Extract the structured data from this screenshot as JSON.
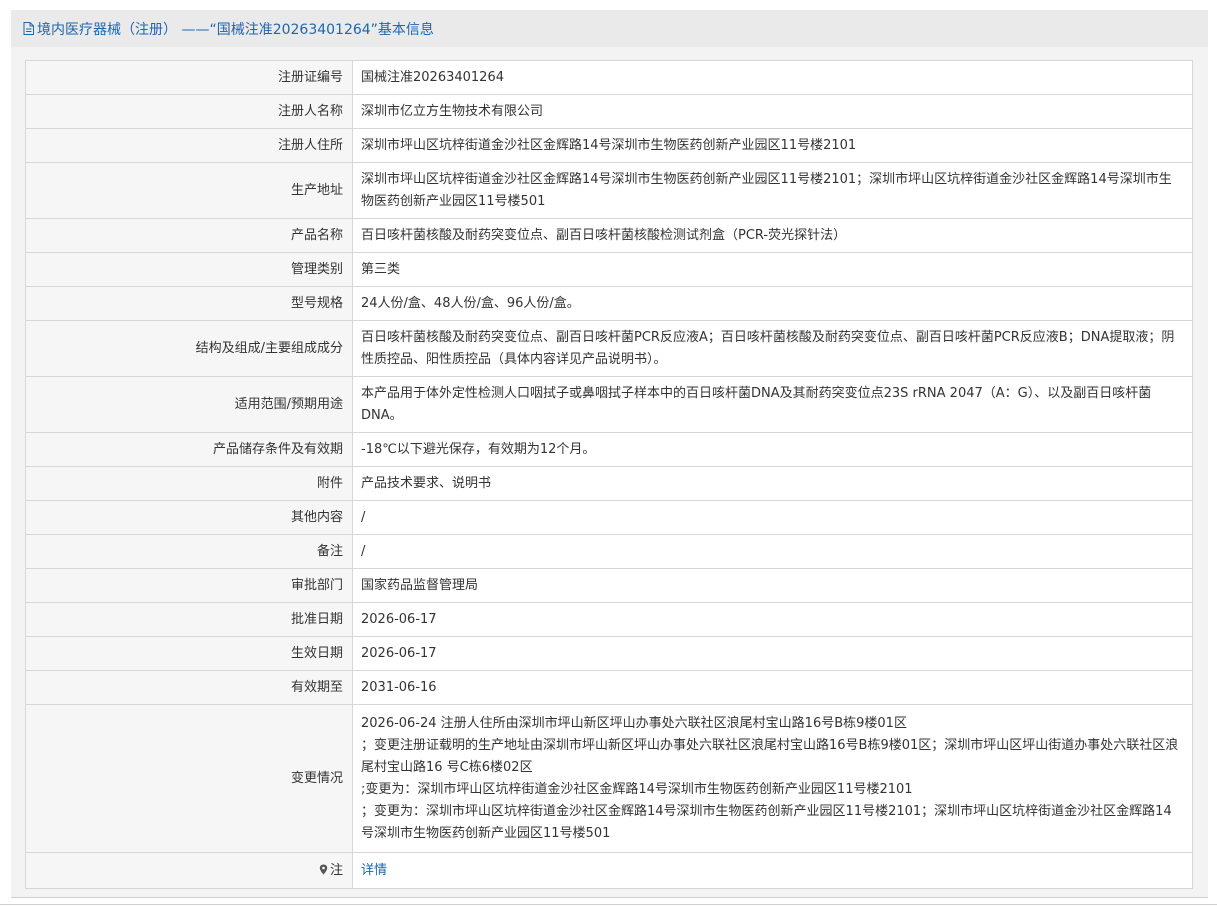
{
  "header": {
    "title": "境内医疗器械（注册） ——“国械注准20263401264”基本信息",
    "icon": "document-icon",
    "color": "#1d66b0"
  },
  "rows": [
    {
      "label": "注册证编号",
      "value": "国械注准20263401264"
    },
    {
      "label": "注册人名称",
      "value": "深圳市亿立方生物技术有限公司"
    },
    {
      "label": "注册人住所",
      "value": "深圳市坪山区坑梓街道金沙社区金辉路14号深圳市生物医药创新产业园区11号楼2101"
    },
    {
      "label": "生产地址",
      "value": "深圳市坪山区坑梓街道金沙社区金辉路14号深圳市生物医药创新产业园区11号楼2101；深圳市坪山区坑梓街道金沙社区金辉路14号深圳市生物医药创新产业园区11号楼501"
    },
    {
      "label": "产品名称",
      "value": "百日咳杆菌核酸及耐药突变位点、副百日咳杆菌核酸检测试剂盒（PCR-荧光探针法）"
    },
    {
      "label": "管理类别",
      "value": "第三类"
    },
    {
      "label": "型号规格",
      "value": "24人份/盒、48人份/盒、96人份/盒。"
    },
    {
      "label": "结构及组成/主要组成成分",
      "value": "百日咳杆菌核酸及耐药突变位点、副百日咳杆菌PCR反应液A；百日咳杆菌核酸及耐药突变位点、副百日咳杆菌PCR反应液B；DNA提取液；阴性质控品、阳性质控品（具体内容详见产品说明书）。"
    },
    {
      "label": "适用范围/预期用途",
      "value": "本产品用于体外定性检测人口咽拭子或鼻咽拭子样本中的百日咳杆菌DNA及其耐药突变位点23S rRNA 2047（A：G）、以及副百日咳杆菌DNA。"
    },
    {
      "label": "产品储存条件及有效期",
      "value": "-18℃以下避光保存，有效期为12个月。"
    },
    {
      "label": "附件",
      "value": "产品技术要求、说明书"
    },
    {
      "label": "其他内容",
      "value": "/"
    },
    {
      "label": "备注",
      "value": "/"
    },
    {
      "label": "审批部门",
      "value": "国家药品监督管理局"
    },
    {
      "label": "批准日期",
      "value": "2026-06-17"
    },
    {
      "label": "生效日期",
      "value": "2026-06-17"
    },
    {
      "label": "有效期至",
      "value": "2031-06-16"
    }
  ],
  "changes": {
    "label": "变更情况",
    "lines": [
      "2026-06-24 注册人住所由深圳市坪山新区坪山办事处六联社区浪尾村宝山路16号B栋9楼01区",
      "；变更注册证载明的生产地址由深圳市坪山新区坪山办事处六联社区浪尾村宝山路16号B栋9楼01区；深圳市坪山区坪山街道办事处六联社区浪尾村宝山路16 号C栋6楼02区",
      ";变更为：深圳市坪山区坑梓街道金沙社区金辉路14号深圳市生物医药创新产业园区11号楼2101",
      "；变更为：深圳市坪山区坑梓街道金沙社区金辉路14号深圳市生物医药创新产业园区11号楼2101；深圳市坪山区坑梓街道金沙社区金辉路14号深圳市生物医药创新产业园区11号楼501"
    ]
  },
  "note": {
    "label": "注",
    "icon": "pin-icon",
    "link_text": "详情",
    "link_color": "#1d66b0"
  }
}
